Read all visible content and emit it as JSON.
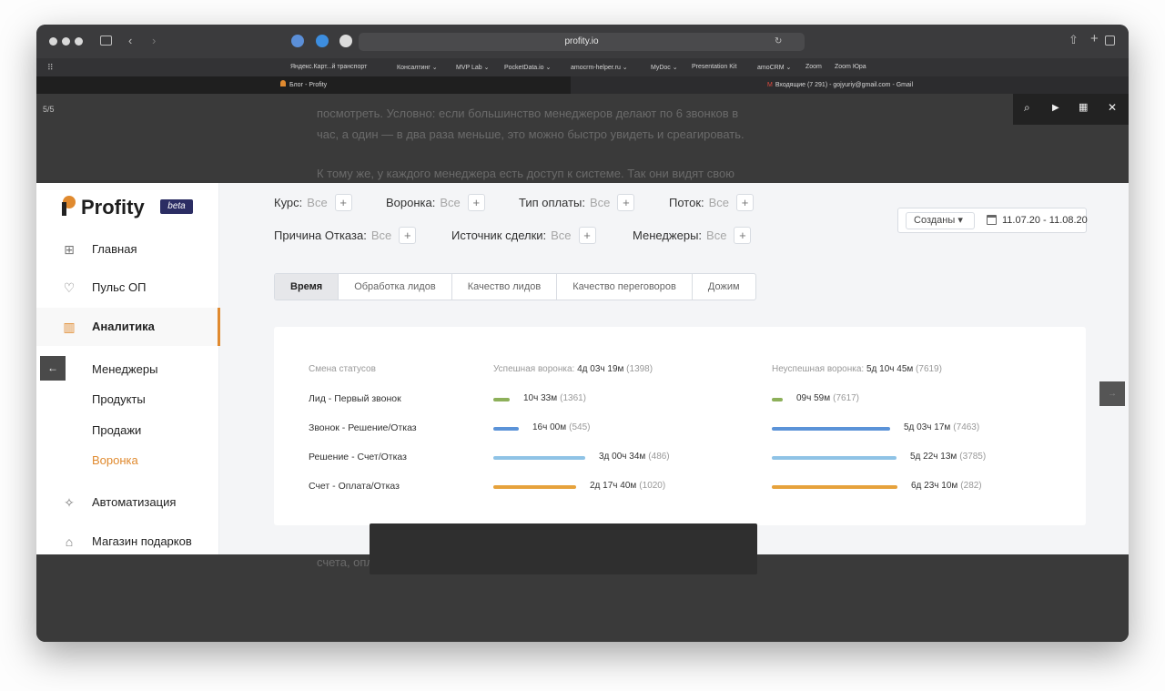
{
  "browser": {
    "url": "profity.io",
    "bookmarks": [
      "Яндекс.Карт...й транспорт",
      "Консалтинг ⌄",
      "MVP Lab ⌄",
      "PocketData.io ⌄",
      "amocrm-helper.ru ⌄",
      "MyDoc ⌄",
      "Presentation Kit",
      "amoCRM ⌄",
      "Zoom",
      "Zoom Юра"
    ],
    "tabs": {
      "active": "Блог - Profity",
      "inactive": "Входящие (7 291) - gojyuriy@gmail.com - Gmail"
    }
  },
  "viewer": {
    "counter": "5/5"
  },
  "article": {
    "lines": [
      "посмотреть. Условно: если большинство менеджеров делают по 6 звонков в",
      "час, а один — в два раза меньше, это можно быстро увидеть и среагировать.",
      "К тому же, у каждого менеджера есть доступ к системе. Так они видят свою",
      "счета, оплаты, конверсия."
    ]
  },
  "app": {
    "logo": "Profity",
    "beta": "beta",
    "nav": [
      {
        "label": "Главная",
        "icon": "layout-icon"
      },
      {
        "label": "Пульс ОП",
        "icon": "heartbeat-icon"
      },
      {
        "label": "Аналитика",
        "icon": "bar-chart-icon"
      }
    ],
    "sub_nav": [
      "Менеджеры",
      "Продукты",
      "Продажи",
      "Воронка"
    ],
    "nav_bottom": [
      {
        "label": "Автоматизация",
        "icon": "sparkle-icon"
      },
      {
        "label": "Магазин подарков",
        "icon": "gift-icon"
      }
    ],
    "filters": [
      {
        "label": "Курс:",
        "value": "Все"
      },
      {
        "label": "Воронка:",
        "value": "Все"
      },
      {
        "label": "Тип оплаты:",
        "value": "Все"
      },
      {
        "label": "Поток:",
        "value": "Все"
      },
      {
        "label": "Причина Отказа:",
        "value": "Все"
      },
      {
        "label": "Источник сделки:",
        "value": "Все"
      },
      {
        "label": "Менеджеры:",
        "value": "Все"
      }
    ],
    "plus": "+",
    "date_filter": {
      "mode": "Созданы ▾",
      "range": "11.07.20 - 11.08.20"
    },
    "tabs": [
      "Время",
      "Обработка лидов",
      "Качество лидов",
      "Качество переговоров",
      "Дожим"
    ],
    "table": {
      "col_status": "Смена статусов",
      "col_success_label": "Успешная воронка:",
      "col_success_value": "4д 03ч 19м",
      "col_success_count": "(1398)",
      "col_fail_label": "Неуспешная воронка:",
      "col_fail_value": "5д 10ч 45м",
      "col_fail_count": "(7619)",
      "rows": [
        {
          "label": "Лид - Первый звонок",
          "s_value": "10ч 33м",
          "s_count": "(1361)",
          "s_frac": 0.13,
          "f_value": "09ч 59м",
          "f_count": "(7617)",
          "f_frac": 0.07,
          "color": "#8db05a"
        },
        {
          "label": "Звонок - Решение/Отказ",
          "s_value": "16ч 00м",
          "s_count": "(545)",
          "s_frac": 0.2,
          "f_value": "5д 03ч 17м",
          "f_count": "(7463)",
          "f_frac": 0.94,
          "color": "#5b93d8"
        },
        {
          "label": "Решение - Счет/Отказ",
          "s_value": "3д 00ч 34м",
          "s_count": "(486)",
          "s_frac": 0.73,
          "f_value": "5д 22ч 13м",
          "f_count": "(3785)",
          "f_frac": 0.99,
          "color": "#8fc3e6"
        },
        {
          "label": "Счет - Оплата/Отказ",
          "s_value": "2д 17ч 40м",
          "s_count": "(1020)",
          "s_frac": 0.66,
          "f_value": "6д 23ч 10м",
          "f_count": "(282)",
          "f_frac": 1.0,
          "color": "#e6a23c"
        }
      ]
    }
  }
}
